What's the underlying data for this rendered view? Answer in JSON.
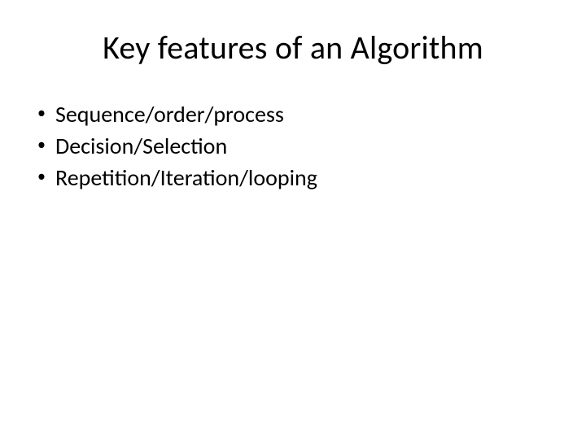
{
  "slide": {
    "title": "Key features of an Algorithm",
    "bullets": [
      {
        "text": "Sequence/order/process"
      },
      {
        "text": "Decision/Selection"
      },
      {
        "text": "Repetition/Iteration/looping"
      }
    ]
  }
}
